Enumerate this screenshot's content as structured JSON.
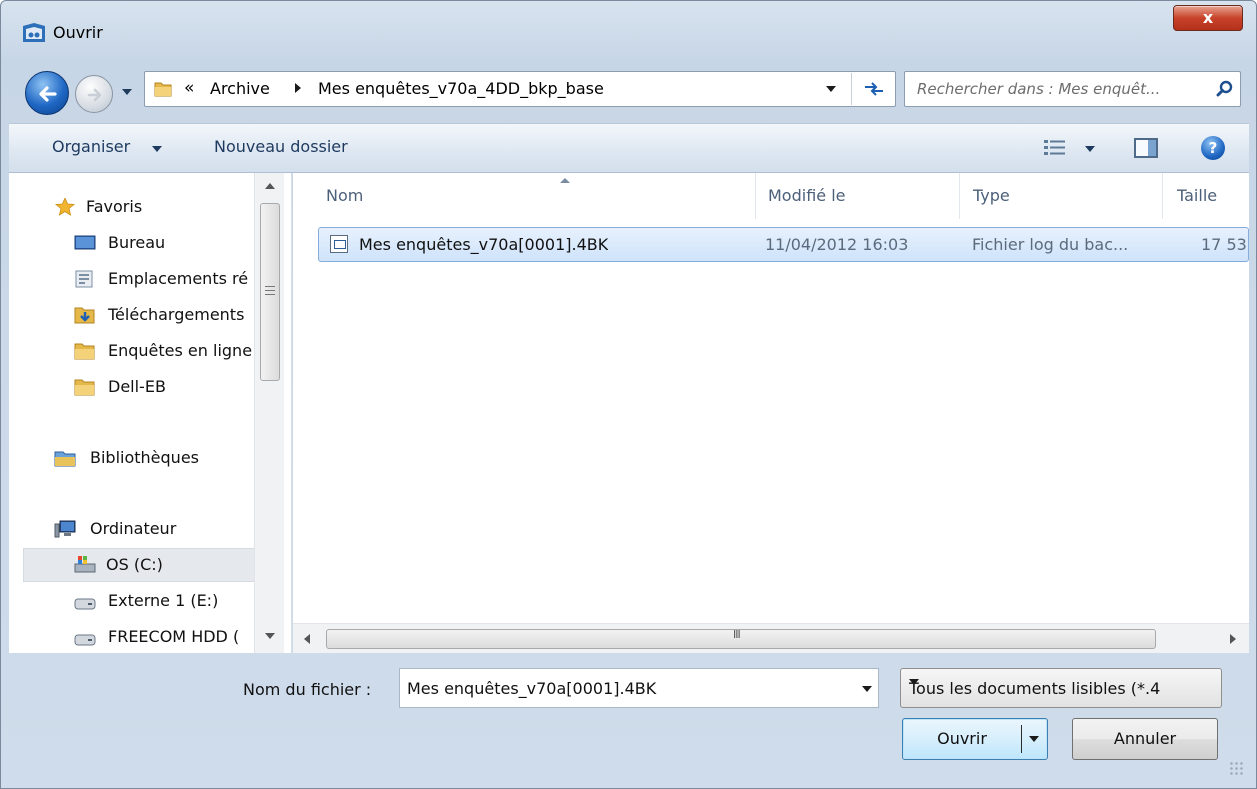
{
  "window": {
    "title": "Ouvrir",
    "close_label": "x"
  },
  "address_bar": {
    "overflow_chevron": "«",
    "breadcrumbs": [
      "Archive",
      "Mes enquêtes_v70a_4DD_bkp_base"
    ],
    "refresh_glyph": "↶↷"
  },
  "search": {
    "placeholder": "Rechercher dans : Mes enquêt..."
  },
  "toolbar": {
    "organiser_label": "Organiser",
    "new_folder_label": "Nouveau dossier"
  },
  "nav": {
    "items": [
      {
        "label": "Favoris",
        "icon": "star-icon"
      },
      {
        "label": "Bureau",
        "icon": "desktop-icon"
      },
      {
        "label": "Emplacements ré",
        "icon": "recent-places-icon"
      },
      {
        "label": "Téléchargements",
        "icon": "downloads-folder-icon"
      },
      {
        "label": "Enquêtes en ligne",
        "icon": "folder-icon"
      },
      {
        "label": "Dell-EB",
        "icon": "folder-icon"
      },
      {
        "label": "Bibliothèques",
        "icon": "libraries-icon"
      },
      {
        "label": "Ordinateur",
        "icon": "computer-icon"
      },
      {
        "label": "OS (C:)",
        "icon": "os-drive-icon",
        "selected": true
      },
      {
        "label": "Externe 1 (E:)",
        "icon": "drive-icon"
      },
      {
        "label": "FREECOM HDD (",
        "icon": "drive-icon"
      }
    ]
  },
  "file_list": {
    "columns": [
      "Nom",
      "Modifié le",
      "Type",
      "Taille"
    ],
    "rows": [
      {
        "name": "Mes enquêtes_v70a[0001].4BK",
        "modified": "11/04/2012 16:03",
        "type": "Fichier log du bac...",
        "size": "17 53",
        "selected": true
      }
    ],
    "hscroll_grip": "III"
  },
  "footer": {
    "filename_label": "Nom du fichier :",
    "filename_value": "Mes enquêtes_v70a[0001].4BK",
    "filter_value": "Tous les documents lisibles (*.4",
    "open_label": "Ouvrir",
    "cancel_label": "Annuler"
  },
  "colors": {
    "selection_fill": "#cfe3fb",
    "selection_border": "#84acdd",
    "close_button": "#c7432a",
    "header_text": "#4c607a"
  }
}
